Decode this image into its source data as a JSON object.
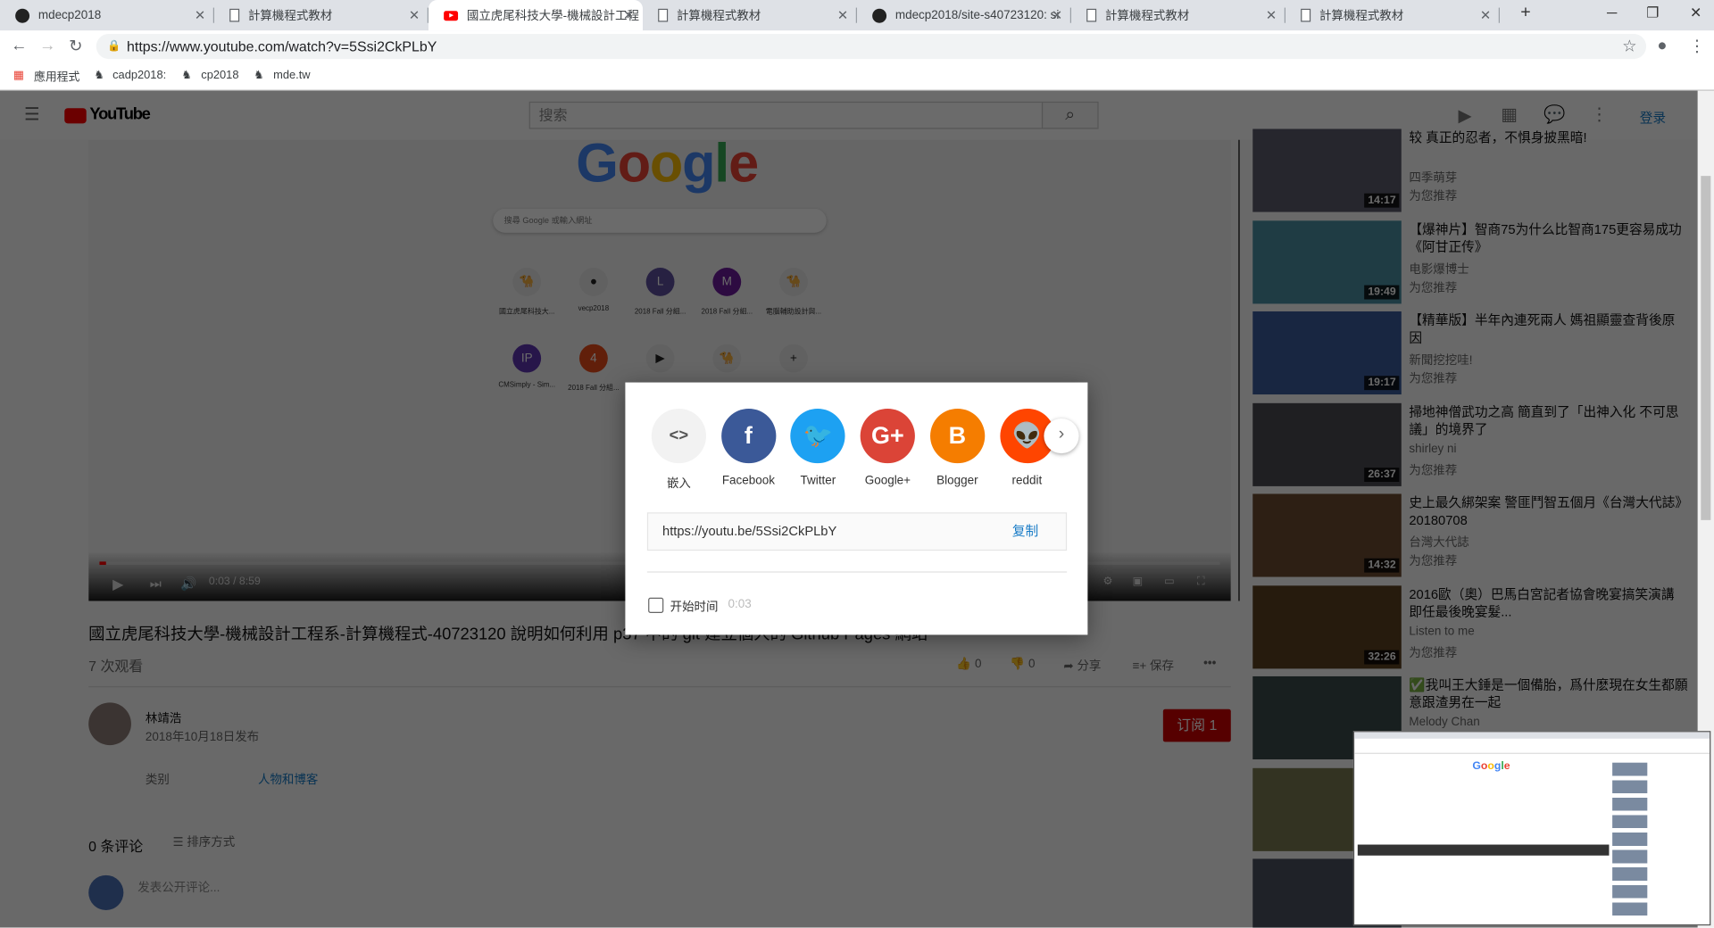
{
  "browser": {
    "tabs": [
      {
        "title": "mdecp2018",
        "icon": "github-icon"
      },
      {
        "title": "計算機程式教材",
        "icon": "document-icon"
      },
      {
        "title": "國立虎尾科技大學-機械設計工程",
        "icon": "youtube-icon",
        "active": true
      },
      {
        "title": "計算機程式教材",
        "icon": "document-icon"
      },
      {
        "title": "mdecp2018/site-s40723120: si",
        "icon": "github-icon"
      },
      {
        "title": "計算機程式教材",
        "icon": "document-icon"
      },
      {
        "title": "計算機程式教材",
        "icon": "document-icon"
      }
    ],
    "url": "https://www.youtube.com/watch?v=5Ssi2CkPLbY",
    "bookmarks": [
      "應用程式",
      "cadp2018:",
      "cp2018",
      "mde.tw"
    ]
  },
  "youtube": {
    "logo": "YouTube",
    "search_placeholder": "搜索",
    "login": "登录",
    "video": {
      "time": "0:03 / 8:59",
      "progress_fraction": 0.0056,
      "embedded_page": {
        "search_placeholder": "搜尋 Google 或輸入網址",
        "shortcuts": [
          {
            "label": "國立虎尾科技大...",
            "glyph": "🐪",
            "color": "#e8e8e8"
          },
          {
            "label": "vecp2018",
            "glyph": "●",
            "color": "#e8e8e8"
          },
          {
            "label": "2018 Fall 分組...",
            "glyph": "L",
            "color": "#5c4f9c"
          },
          {
            "label": "2018 Fall 分組...",
            "glyph": "M",
            "color": "#6a1b9a"
          },
          {
            "label": "電腦輔助設計與...",
            "glyph": "🐪",
            "color": "#e8e8e8"
          },
          {
            "label": "CMSimply - Sim...",
            "glyph": "IP",
            "color": "#5e35b1"
          },
          {
            "label": "2018 Fall 分組...",
            "glyph": "4",
            "color": "#e64a19"
          },
          {
            "label": "",
            "glyph": "▶",
            "color": "#e8e8e8"
          },
          {
            "label": "",
            "glyph": "🐪",
            "color": "#e8e8e8"
          },
          {
            "label": "",
            "glyph": "+",
            "color": "#e8e8e8"
          }
        ]
      }
    },
    "title": "國立虎尾科技大學-機械設計工程系-計算機程式-40723120 說明如何利用 p37 中的 git 建立個人的 Github Pages 網站",
    "views": "7 次观看",
    "likes": "0",
    "dislikes": "0",
    "share": "分享",
    "save": "保存",
    "channel": "林靖浩",
    "published": "2018年10月18日发布",
    "subscribe": "订阅 1",
    "category_label": "类别",
    "category": "人物和博客",
    "comments_count": "0 条评论",
    "sort": "排序方式",
    "comment_placeholder": "发表公开评论...",
    "sidebar": [
      {
        "title": "较 真正的忍者，不惧身披黑暗!",
        "channel": "四季萌芽",
        "rec": "为您推荐",
        "duration": "14:17",
        "color": "#5a5a6a"
      },
      {
        "title": "【爆神片】智商75为什么比智商175更容易成功《阿甘正传》",
        "channel": "电影爆博士",
        "rec": "为您推荐",
        "duration": "19:49",
        "color": "#4a8fa3"
      },
      {
        "title": "【精華版】半年內連死兩人 媽祖顯靈查背後原因",
        "channel": "新聞挖挖哇!",
        "rec": "为您推荐",
        "duration": "19:17",
        "color": "#3a5a9a"
      },
      {
        "title": "掃地神僧武功之高 簡直到了「出神入化 不可思議」的境界了",
        "channel": "shirley ni",
        "rec": "为您推荐",
        "duration": "26:37",
        "color": "#4a4a52"
      },
      {
        "title": "史上最久綁架案 警匪鬥智五個月《台灣大代誌》20180708",
        "channel": "台灣大代誌",
        "rec": "为您推荐",
        "duration": "14:32",
        "color": "#6a4a30"
      },
      {
        "title": "2016歐（奧）巴馬白宮記者協會晚宴搞笑演講 即任最後晚宴髮...",
        "channel": "Listen to me",
        "rec": "为您推荐",
        "duration": "32:26",
        "color": "#5a4020"
      },
      {
        "title": "✅我叫王大錘是一個備胎，爲什麽現在女生都願意跟渣男在一起",
        "channel": "Melody Chan",
        "rec": "",
        "duration": "",
        "color": "#3a4a4a"
      },
      {
        "title": "",
        "channel": "",
        "rec": "",
        "duration": "",
        "color": "#7a7a50"
      },
      {
        "title": "",
        "channel": "",
        "rec": "",
        "duration": "",
        "color": "#4a5060"
      }
    ]
  },
  "share_dialog": {
    "targets": [
      {
        "label": "嵌入",
        "glyph": "<>",
        "color": "#f2f2f2"
      },
      {
        "label": "Facebook",
        "glyph": "f",
        "color": "#3b5998"
      },
      {
        "label": "Twitter",
        "glyph": "🐦",
        "color": "#1da1f2"
      },
      {
        "label": "Google+",
        "glyph": "G+",
        "color": "#db4437"
      },
      {
        "label": "Blogger",
        "glyph": "B",
        "color": "#f57d00"
      },
      {
        "label": "reddit",
        "glyph": "👽",
        "color": "#ff4500"
      }
    ],
    "share_url": "https://youtu.be/5Ssi2CkPLbY",
    "copy": "复制",
    "start_time_label": "开始时间",
    "start_time": "0:03"
  }
}
